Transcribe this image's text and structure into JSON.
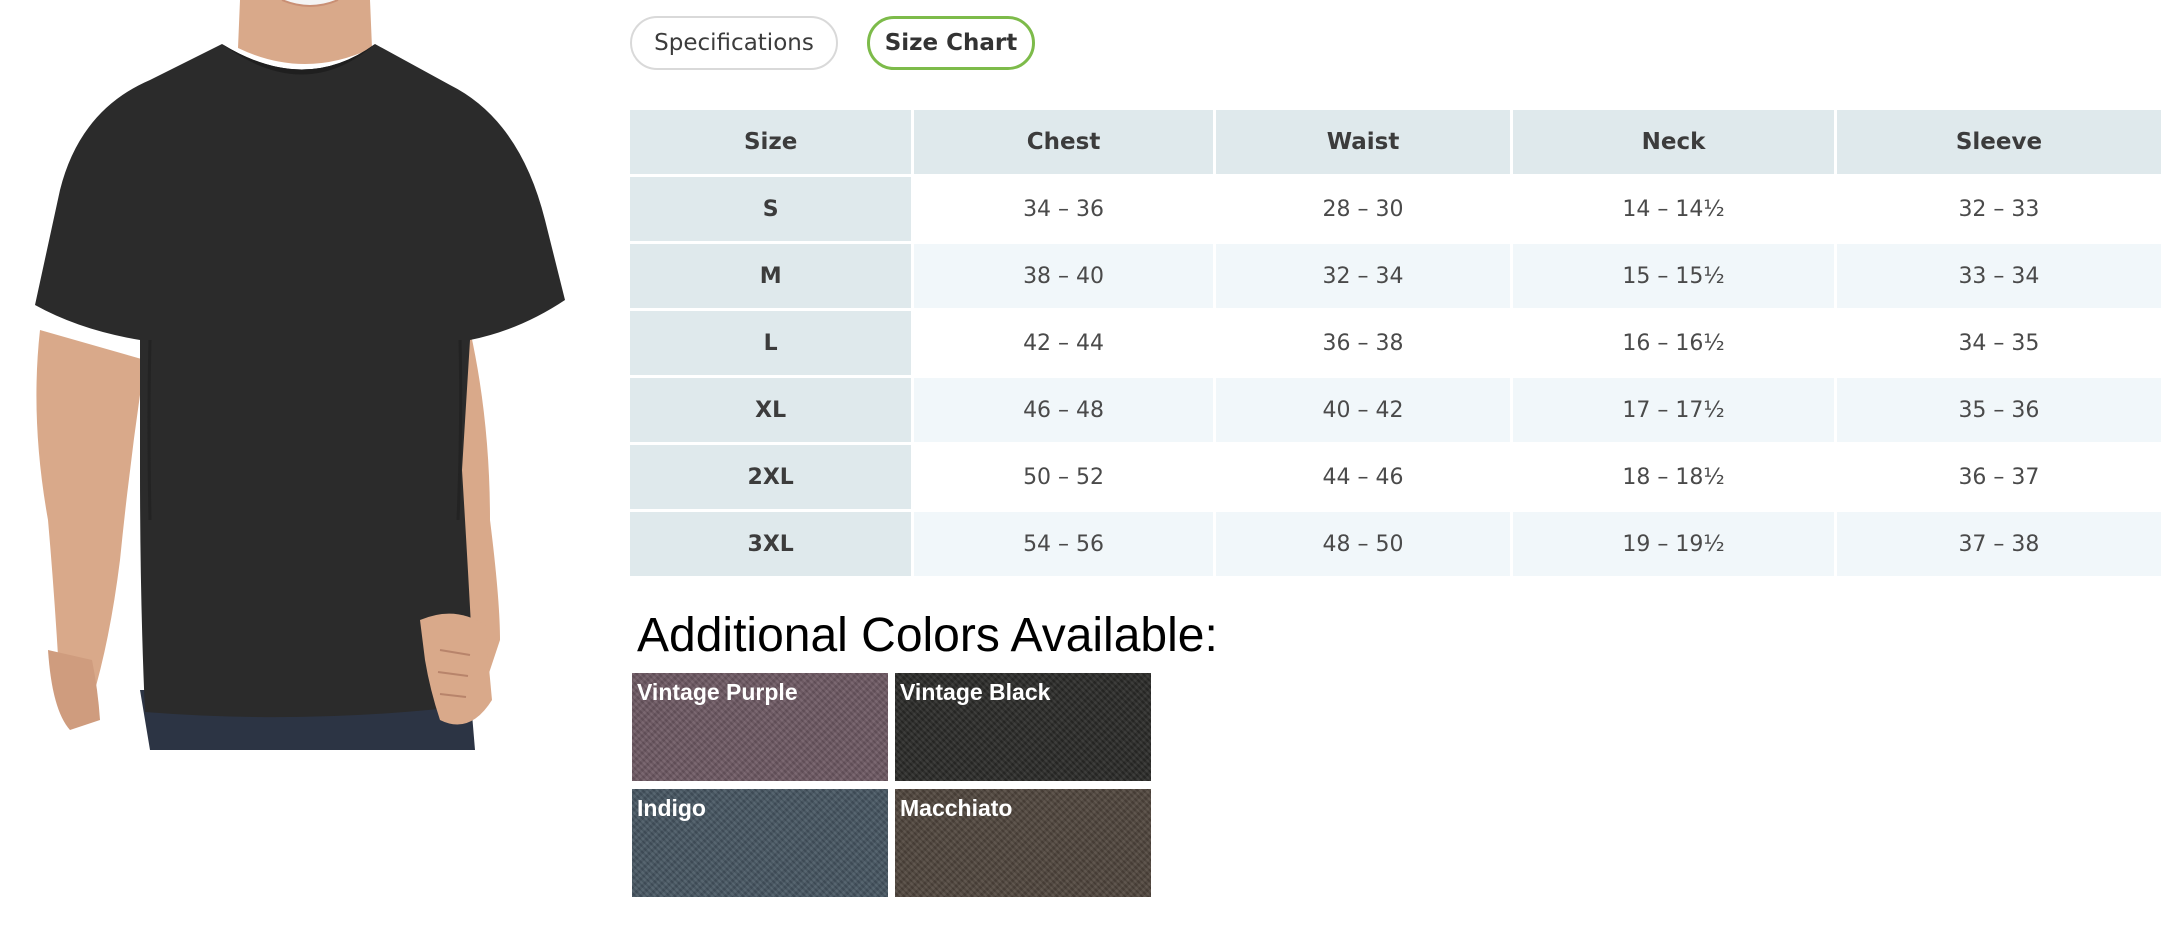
{
  "tabs": {
    "specifications_label": "Specifications",
    "size_chart_label": "Size Chart",
    "active": "Size Chart"
  },
  "size_table": {
    "headers": [
      "Size",
      "Chest",
      "Waist",
      "Neck",
      "Sleeve"
    ],
    "rows": [
      [
        "S",
        "34 – 36",
        "28 – 30",
        "14 – 14½",
        "32 – 33"
      ],
      [
        "M",
        "38 – 40",
        "32 – 34",
        "15 – 15½",
        "33 – 34"
      ],
      [
        "L",
        "42 – 44",
        "36 – 38",
        "16 – 16½",
        "34 – 35"
      ],
      [
        "XL",
        "46 – 48",
        "40 – 42",
        "17 – 17½",
        "35 – 36"
      ],
      [
        "2XL",
        "50 – 52",
        "44 – 46",
        "18 – 18½",
        "36 – 37"
      ],
      [
        "3XL",
        "54 – 56",
        "48 – 50",
        "19 – 19½",
        "37 – 38"
      ]
    ]
  },
  "colors": {
    "heading": "Additional Colors Available:",
    "swatches": [
      {
        "name": "Vintage Purple",
        "color": "#6d5862"
      },
      {
        "name": "Vintage Black",
        "color": "#2a2a28"
      },
      {
        "name": "Indigo",
        "color": "#465561"
      },
      {
        "name": "Macchiato",
        "color": "#4f453c"
      }
    ]
  },
  "product_image": {
    "shirt_color": "#2b2b2b",
    "skin_color": "#d9a98a",
    "jeans_color": "#2c3444"
  }
}
